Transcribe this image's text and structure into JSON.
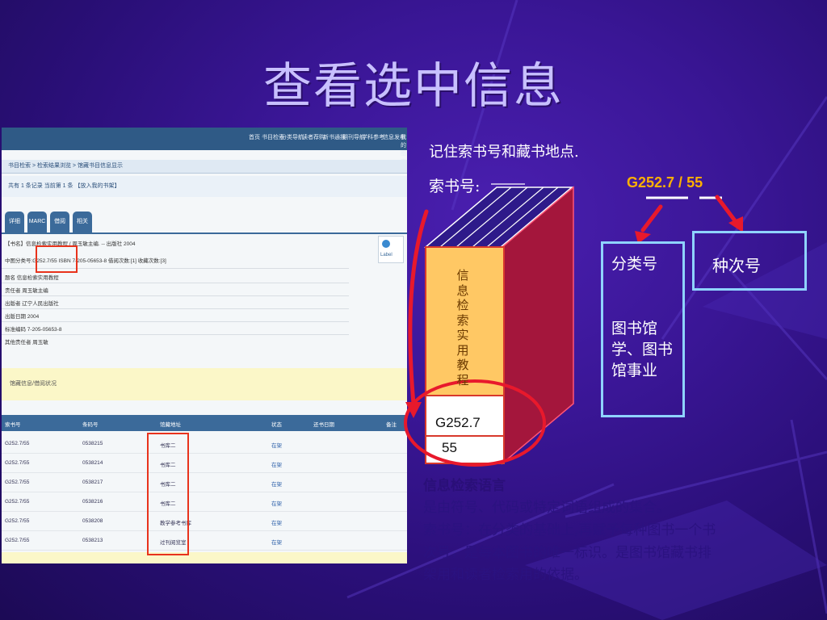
{
  "slide": {
    "title": "查看选中信息",
    "note": "记住索书号和藏书地点.",
    "call_number_label": "索书号:",
    "call_number": {
      "class_part": "G252.7",
      "slash": " / ",
      "seq_part": "55"
    },
    "class_box": {
      "title": "分类号",
      "desc": "图书馆学、图书馆事业"
    },
    "seq_box": {
      "title": "种次号"
    },
    "book": {
      "title": "信息检索实用教程",
      "spine_line1": "G252.7",
      "spine_line2": "55"
    },
    "definition": {
      "title": "信息检索语言",
      "lines": [
        "    是由符号、代码或特定词语组成的集合。",
        "索书号：在分类的基础上,再赋予每种图书一个书",
        "次号，是每本图书的唯一标识。是图书馆藏书排",
        "架用和读者检索用的依据。"
      ]
    },
    "colors": {
      "background": "#3a1696",
      "accent": "#ffb000",
      "box_border": "#8fd3ff",
      "arrow": "#e8192c"
    }
  },
  "screenshot": {
    "nav_items": [
      "首页",
      "书目检索",
      "分类导航",
      "读者荐购",
      "新书通报",
      "期刊导航",
      "学科参考",
      "信息发布",
      "我的图书馆"
    ],
    "breadcrumb": "书目检索 > 检索结果浏览 > 馆藏书目信息显示",
    "subbar": "共有 1 条记录  当前第 1 条  【放入我的书架】",
    "tabs": [
      "详细",
      "MARC",
      "借阅",
      "相关"
    ],
    "record_rows": [
      "【书名】信息检索实用教程 / 周玉敏主编. -- 出版社 2004",
      "中图分类号:G252.7/55   ISBN 7-205-05653-8  借阅次数:[1]  收藏次数:[3]",
      "题名  信息检索实用教程",
      "责任者  周玉敏主编",
      "出版者  辽宁人民出版社",
      "出版日期  2004",
      "标准编码  7-205-05653-8",
      "其他责任者  周玉敏"
    ],
    "label_box": "Label",
    "holdings_bar": "馆藏信息/借阅状况",
    "table_headers": [
      "索书号",
      "条码号",
      "馆藏地址",
      "状态",
      "还书日期",
      "备注"
    ],
    "table_rows": [
      [
        "G252.7/55",
        "0538215",
        "书库二",
        "在架",
        "",
        ""
      ],
      [
        "G252.7/55",
        "0538214",
        "书库二",
        "在架",
        "",
        ""
      ],
      [
        "G252.7/55",
        "0538217",
        "书库二",
        "在架",
        "",
        ""
      ],
      [
        "G252.7/55",
        "0538216",
        "书库二",
        "在架",
        "",
        ""
      ],
      [
        "G252.7/55",
        "0538208",
        "教学参考书库",
        "在架",
        "",
        ""
      ],
      [
        "G252.7/55",
        "0538213",
        "过刊阅览室",
        "在架",
        "",
        ""
      ]
    ]
  }
}
